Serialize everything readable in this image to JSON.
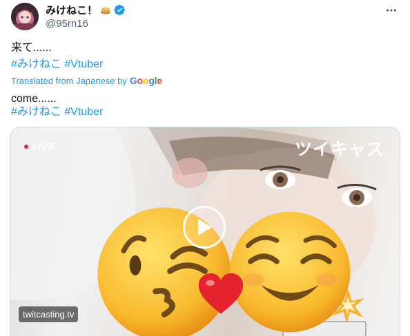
{
  "tweet": {
    "display_name": "みけねこ！",
    "name_emoji_icon": "pancake-icon",
    "handle": "@95rn16",
    "original_text": "来て......",
    "hashtags": [
      "#みけねこ",
      "#Vtuber"
    ],
    "translated_label": "Translated from Japanese by",
    "translator_brand": "Google",
    "translated_text": "come......",
    "translated_hashtags": [
      "#みけねこ",
      "#Vtuber"
    ],
    "accent_color": "#1d9bf0"
  },
  "media": {
    "live_label": "LIVE",
    "brand_label": "ツイキャス",
    "watermark": "twitcasting.tv",
    "play_icon": "play-icon",
    "emojis": [
      "kissing-face-icon",
      "heart-icon",
      "smiling-face-icon",
      "collision-icon"
    ]
  }
}
